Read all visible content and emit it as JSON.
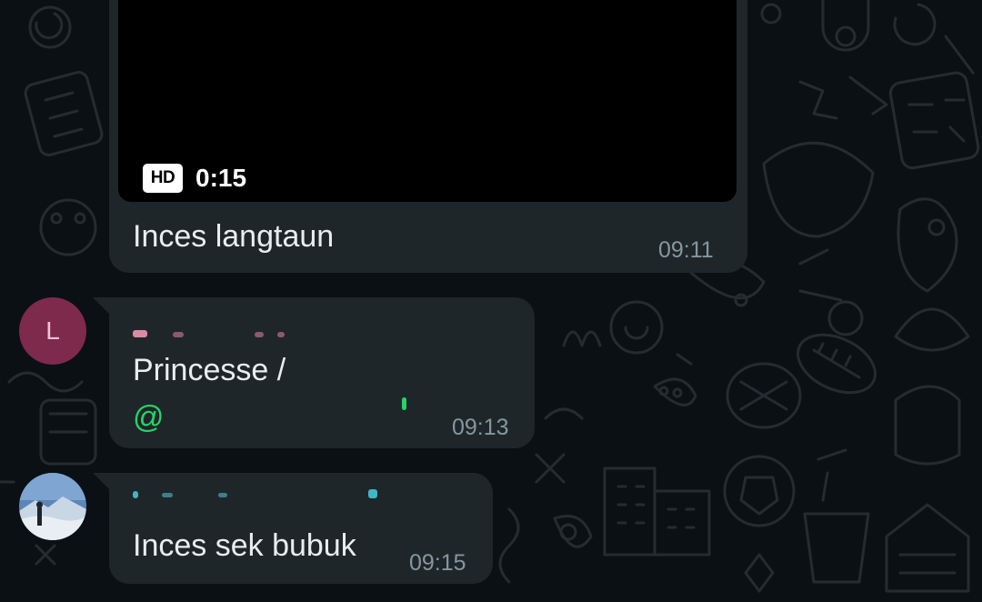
{
  "messages": [
    {
      "type": "video",
      "badge": "HD",
      "duration": "0:15",
      "caption": "Inces langtaun",
      "time": "09:11"
    },
    {
      "type": "text",
      "avatar_letter": "L",
      "text": "Princesse /",
      "mention_symbol": "@",
      "time": "09:13"
    },
    {
      "type": "text",
      "text": "Inces sek bubuk",
      "time": "09:15"
    }
  ],
  "colors": {
    "background": "#0b1014",
    "bubble": "#1f2629",
    "text": "#e9edef",
    "time": "#8696a0",
    "mention": "#25d366",
    "avatar_l": "#7d2a4d"
  }
}
